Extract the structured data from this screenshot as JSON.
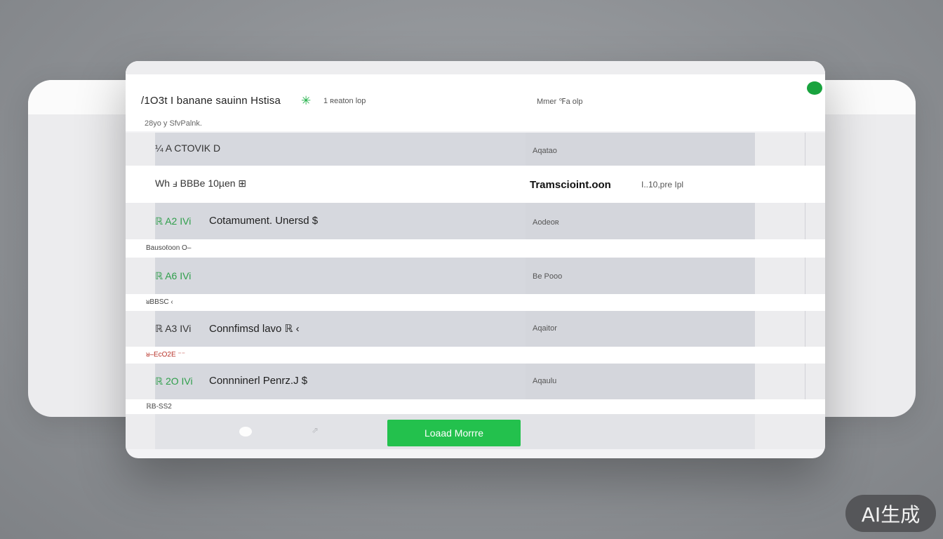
{
  "header": {
    "title": "/1O3t  I banane sauinn Hstisa",
    "meta_left": "1 ʀeaton  lop",
    "meta_right": "Mmer ℉a olp",
    "subtitle": "28yo y SfvPalnk."
  },
  "rows": [
    {
      "code": "¼ A CTOVIK D",
      "status": "Aqatao"
    },
    {
      "code": "Wh ⅎ BBBe  10µen ⊞",
      "bold": "Tramscioint.oon",
      "extra": "I..10,pre  Ipl"
    },
    {
      "code": "ℝ A2  IVi",
      "name": "Cotamument. Unersd  $",
      "status": "Aodeoʀ"
    },
    {
      "code": "ℝ A6  IVi",
      "status": "Be Pooo"
    },
    {
      "code": "ℝ A3  IVi",
      "name": "Connfimsd  lavo  ℝ    ‹",
      "status": "Aqaitor"
    },
    {
      "code": "ℝ 2O  IVi",
      "name": "Connninerl  Penrz.J  $",
      "status": "Aqaulu"
    }
  ],
  "separators": [
    {
      "label": "Bausoℓoon O–"
    },
    {
      "label": "ᴚBBSC ‹"
    },
    {
      "label": "ᴚ–EcΟ2E ⁻⁻",
      "color": "#b8342b"
    },
    {
      "label": "ℝB‑SS2"
    }
  ],
  "footer": {
    "load_more_label": "Loaad Morrre",
    "arrow_glyph": "⇗"
  },
  "icons": {
    "spark": "✳",
    "status_dot": "status-indicator-icon"
  },
  "colors": {
    "accent": "#23c14d",
    "status_dot": "#19a33e"
  },
  "watermark": "AI生成"
}
